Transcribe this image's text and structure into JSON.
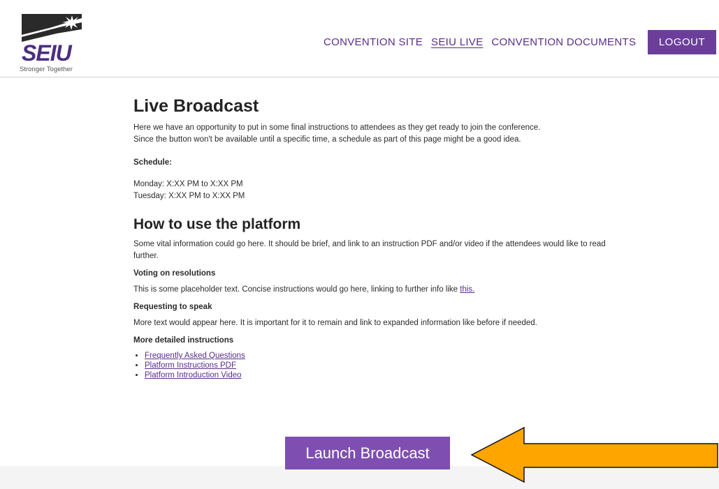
{
  "logo": {
    "wordmark": "SEIU",
    "tagline": "Stronger Together"
  },
  "nav": {
    "items": [
      {
        "label": "CONVENTION SITE",
        "active": false
      },
      {
        "label": "SEIU LIVE",
        "active": true
      },
      {
        "label": "CONVENTION DOCUMENTS",
        "active": false
      }
    ],
    "logout_label": "LOGOUT"
  },
  "broadcast": {
    "title": "Live Broadcast",
    "intro_line1": "Here we have an opportunity to put in some final instructions to attendees as they get ready to join the conference.",
    "intro_line2": "Since the button won't be available until a specific time, a schedule as part of this page might be a good idea.",
    "schedule_label": "Schedule:",
    "schedule": [
      "Monday: X:XX PM to X:XX PM",
      "Tuesday: X:XX PM to X:XX PM"
    ]
  },
  "platform": {
    "title": "How to use the platform",
    "intro": "Some vital information could go here. It should be brief, and link to an instruction PDF and/or video if the attendees would like to read further.",
    "voting_heading": "Voting on resolutions",
    "voting_text": "This is some placeholder text. Concise instructions would go here, linking to further info like ",
    "voting_link": "this.",
    "speak_heading": "Requesting to speak",
    "speak_text": "More text would appear here. It is important for it to remain and link to expanded information like before if needed.",
    "more_heading": "More detailed instructions",
    "links": [
      "Frequently Asked Questions",
      "Platform Instructions PDF",
      "Platform Introduction Video"
    ]
  },
  "launch_label": "Launch Broadcast",
  "colors": {
    "brand_purple": "#6b3f99",
    "button_purple": "#7e4fb0",
    "arrow_orange": "#ffa500"
  }
}
